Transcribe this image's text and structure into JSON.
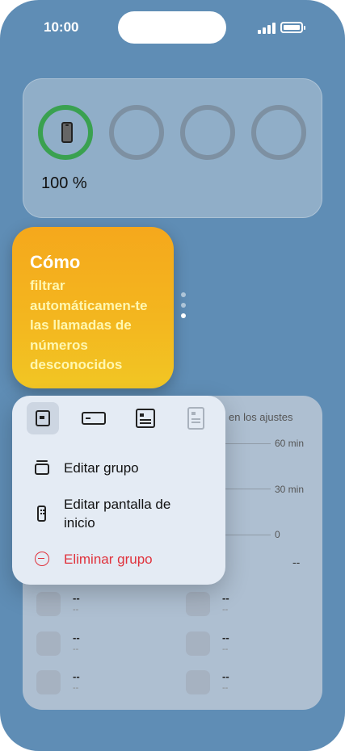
{
  "status_bar": {
    "time": "10:00"
  },
  "battery_widget": {
    "percentage": "100 %",
    "charge_level": 1.0
  },
  "tip_widget": {
    "title": "Cómo",
    "body": "filtrar automáticamen-te las llamadas de números desconocidos"
  },
  "screen_time_widget": {
    "header": "en los ajustes",
    "ticks": [
      "60 min",
      "30 min",
      "0"
    ],
    "total_value": "--",
    "apps": [
      {
        "name": "--",
        "sub": "--"
      },
      {
        "name": "--",
        "sub": "--"
      },
      {
        "name": "--",
        "sub": "--"
      },
      {
        "name": "--",
        "sub": "--"
      },
      {
        "name": "--",
        "sub": "--"
      },
      {
        "name": "--",
        "sub": "--"
      }
    ]
  },
  "context_menu": {
    "sizes": [
      "small",
      "medium",
      "large",
      "extra-large"
    ],
    "selected_size": "small",
    "items": [
      {
        "label": "Editar grupo",
        "icon": "stack-icon"
      },
      {
        "label": "Editar pantalla de inicio",
        "icon": "home-screen-icon"
      },
      {
        "label": "Eliminar grupo",
        "icon": "remove-icon"
      }
    ]
  },
  "colors": {
    "wallpaper": "#5f8db5",
    "battery_ring": "#3aa150",
    "tip_gradient_top": "#f5a81c",
    "tip_text_accent": "#fff7b0",
    "danger": "#e0323c"
  }
}
